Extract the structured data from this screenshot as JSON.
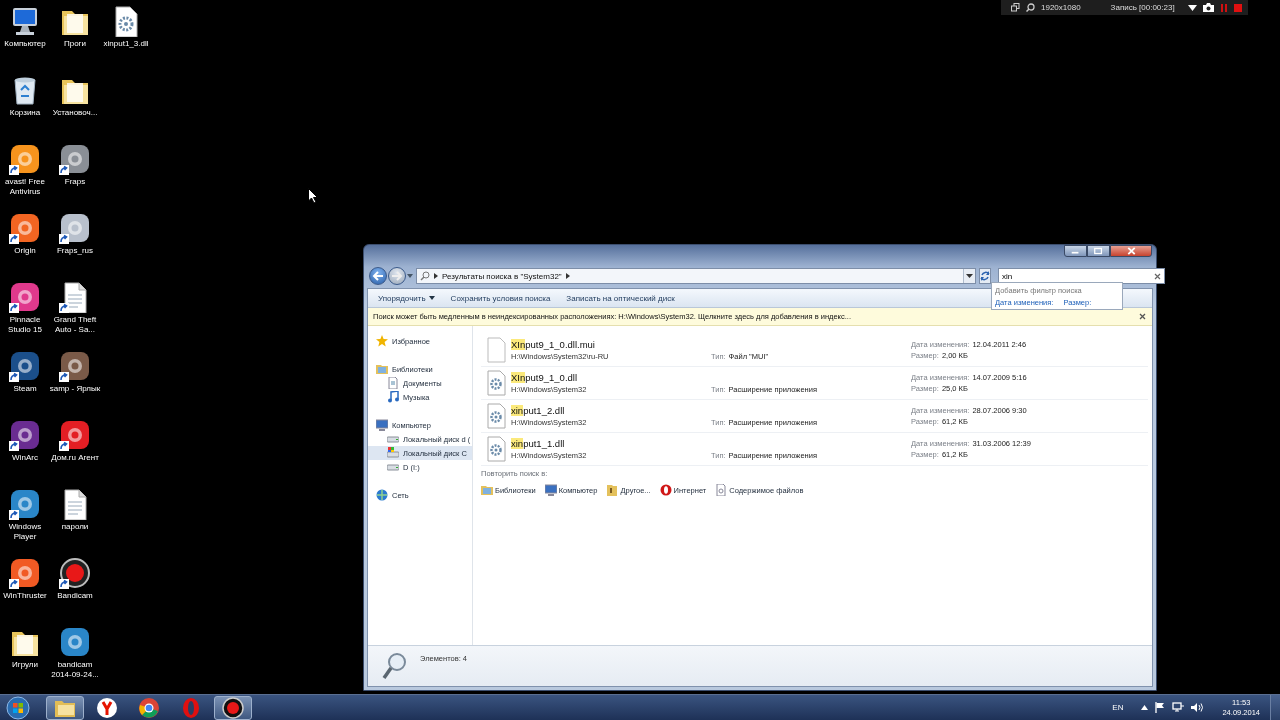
{
  "recording_bar": {
    "resolution": "1920x1080",
    "status": "Запись [00:00:23]"
  },
  "desktop_icons": [
    {
      "label": "Компьютер",
      "kind": "computer",
      "shortcut": false
    },
    {
      "label": "Корзина",
      "kind": "recycle",
      "shortcut": false
    },
    {
      "label": "avast! Free Antivirus",
      "kind": "app",
      "color": "#f7941d",
      "shortcut": true
    },
    {
      "label": "Origin",
      "kind": "app",
      "color": "#f26522",
      "shortcut": true
    },
    {
      "label": "Pinnacle Studio 15",
      "kind": "app",
      "color": "#e0398c",
      "shortcut": true
    },
    {
      "label": "Steam",
      "kind": "app",
      "color": "#1b4f8a",
      "shortcut": true
    },
    {
      "label": "WinArc",
      "kind": "app",
      "color": "#6a2c91",
      "shortcut": true
    },
    {
      "label": "Windows Player",
      "kind": "app",
      "color": "#2a86c8",
      "shortcut": true
    },
    {
      "label": "WinThruster",
      "kind": "app",
      "color": "#f15a24",
      "shortcut": true
    },
    {
      "label": "Игрули",
      "kind": "folder",
      "shortcut": false
    },
    {
      "label": "Проги",
      "kind": "folder",
      "shortcut": false
    },
    {
      "label": "Установоч...",
      "kind": "folder",
      "shortcut": false
    },
    {
      "label": "Fraps",
      "kind": "app",
      "color": "#8a8f96",
      "shortcut": true
    },
    {
      "label": "Fraps_rus",
      "kind": "app",
      "color": "#b8c0cc",
      "shortcut": true
    },
    {
      "label": "Grand Theft Auto - Sa...",
      "kind": "document",
      "shortcut": true
    },
    {
      "label": "samp - Ярлык",
      "kind": "app",
      "color": "#7a5a48",
      "shortcut": true
    },
    {
      "label": "Дом.ru Агент",
      "kind": "app",
      "color": "#e31e24",
      "shortcut": true
    },
    {
      "label": "пароли",
      "kind": "document",
      "shortcut": false
    },
    {
      "label": "Bandicam",
      "kind": "record",
      "shortcut": true
    },
    {
      "label": "bandicam 2014-09-24...",
      "kind": "app",
      "color": "#2a86c8",
      "shortcut": false
    },
    {
      "label": "xinput1_3.dll",
      "kind": "dll",
      "shortcut": false
    }
  ],
  "explorer": {
    "address": "Результаты поиска в \"System32\"",
    "search": {
      "value": "xin"
    },
    "search_suggestions": {
      "title": "Добавить фильтр поиска",
      "filters": [
        "Дата изменения:",
        "Размер:"
      ]
    },
    "toolbar": [
      {
        "label": "Упорядочить",
        "dropdown": true
      },
      {
        "label": "Сохранить условия поиска",
        "dropdown": false
      },
      {
        "label": "Записать на оптический диск",
        "dropdown": false
      }
    ],
    "info_bar": "Поиск может быть медленным в неиндексированных расположениях: H:\\Windows\\System32. Щелкните здесь для добавления в индекс...",
    "nav": [
      {
        "label": "Избранное",
        "kind": "favorites",
        "selected": false
      },
      {
        "label": "Библиотеки",
        "kind": "libraries",
        "selected": false,
        "children": [
          {
            "label": "Документы",
            "kind": "documents",
            "selected": false
          },
          {
            "label": "Музыка",
            "kind": "music",
            "selected": false
          }
        ]
      },
      {
        "label": "Компьютер",
        "kind": "computer",
        "selected": false,
        "children": [
          {
            "label": "Локальный диск d (",
            "kind": "drive",
            "selected": false
          },
          {
            "label": "Локальный диск C",
            "kind": "system_drive",
            "selected": true
          },
          {
            "label": "D (I:)",
            "kind": "drive",
            "selected": false
          }
        ]
      },
      {
        "label": "Сеть",
        "kind": "network",
        "selected": false
      }
    ],
    "files": [
      {
        "kind": "mui",
        "match": "XIn",
        "rest": "put9_1_0.dll.mui",
        "path": "H:\\Windows\\System32\\ru-RU",
        "type_label": "Тип:",
        "type": "Файл \"MUI\"",
        "date_label": "Дата изменения:",
        "date": "12.04.2011 2:46",
        "size_label": "Размер:",
        "size": "2,00 КБ"
      },
      {
        "kind": "dll",
        "match": "XIn",
        "rest": "put9_1_0.dll",
        "path": "H:\\Windows\\System32",
        "type_label": "Тип:",
        "type": "Расширение приложения",
        "date_label": "Дата изменения:",
        "date": "14.07.2009 5:16",
        "size_label": "Размер:",
        "size": "25,0 КБ"
      },
      {
        "kind": "dll",
        "match": "xin",
        "rest": "put1_2.dll",
        "path": "H:\\Windows\\System32",
        "type_label": "Тип:",
        "type": "Расширение приложения",
        "date_label": "Дата изменения:",
        "date": "28.07.2006 9:30",
        "size_label": "Размер:",
        "size": "61,2 КБ"
      },
      {
        "kind": "dll",
        "match": "xin",
        "rest": "put1_1.dll",
        "path": "H:\\Windows\\System32",
        "type_label": "Тип:",
        "type": "Расширение приложения",
        "date_label": "Дата изменения:",
        "date": "31.03.2006 12:39",
        "size_label": "Размер:",
        "size": "61,2 КБ"
      }
    ],
    "retry": {
      "label": "Повторить поиск в:",
      "places": [
        {
          "label": "Библиотеки",
          "kind": "libraries"
        },
        {
          "label": "Компьютер",
          "kind": "computer"
        },
        {
          "label": "Другое...",
          "kind": "other"
        },
        {
          "label": "Интернет",
          "kind": "internet"
        },
        {
          "label": "Содержимое файлов",
          "kind": "contents"
        }
      ]
    },
    "status": "Элементов: 4"
  },
  "taskbar": {
    "apps": [
      {
        "kind": "explorer",
        "active": true
      },
      {
        "kind": "yandex",
        "active": false
      },
      {
        "kind": "chrome",
        "active": false
      },
      {
        "kind": "opera",
        "active": false
      },
      {
        "kind": "bandicam",
        "active": true
      }
    ],
    "language": "EN",
    "time": "11:53",
    "date": "24.09.2014"
  }
}
